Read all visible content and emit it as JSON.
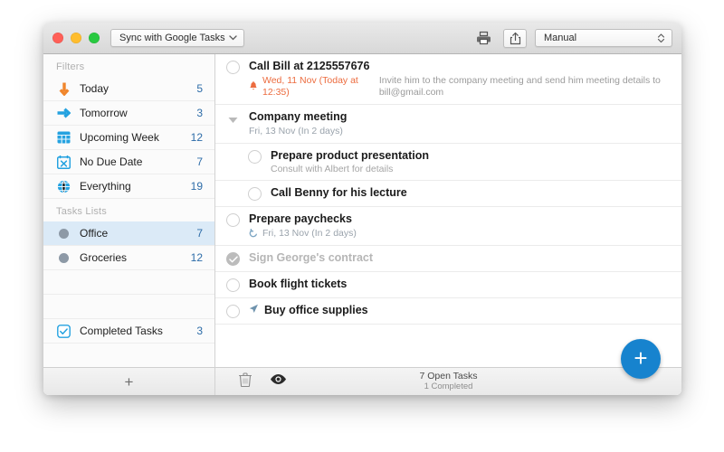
{
  "window": {
    "traffic_lights": [
      "close",
      "minimize",
      "zoom"
    ],
    "sync_popup": {
      "value": "Sync with Google Tasks",
      "icon": "chevron-down-icon"
    },
    "sort_popup": {
      "value": "Manual",
      "icon": "chevron-updown-icon"
    },
    "print_icon": "printer-icon",
    "share_icon": "share-icon"
  },
  "sidebar": {
    "filters_header": "Filters",
    "filters": [
      {
        "label": "Today",
        "count": "5",
        "icon": "arrow-down-icon"
      },
      {
        "label": "Tomorrow",
        "count": "3",
        "icon": "arrow-right-icon"
      },
      {
        "label": "Upcoming Week",
        "count": "12",
        "icon": "calendar-grid-icon"
      },
      {
        "label": "No Due Date",
        "count": "7",
        "icon": "calendar-x-icon"
      },
      {
        "label": "Everything",
        "count": "19",
        "icon": "globe-icon"
      }
    ],
    "lists_header": "Tasks Lists",
    "lists": [
      {
        "label": "Office",
        "count": "7",
        "icon": "list-dot-icon",
        "selected": true
      },
      {
        "label": "Groceries",
        "count": "12",
        "icon": "list-dot-icon",
        "selected": false
      }
    ],
    "completed": {
      "label": "Completed Tasks",
      "count": "3",
      "icon": "checkbox-checked-icon"
    },
    "add_list_icon": "plus-icon"
  },
  "tasks": [
    {
      "title": "Call Bill at 2125557676",
      "state": "open",
      "level": 0,
      "meta_icon": "bell-icon",
      "date": "Wed, 11 Nov (Today at 12:35)",
      "date_style": "due",
      "note": "Invite him to the company meeting and send him meeting details to bill@gmail.com"
    },
    {
      "title": "Company meeting",
      "state": "group",
      "level": 0,
      "meta_icon": "",
      "date": "Fri, 13 Nov (In 2 days)",
      "date_style": "soft",
      "note": ""
    },
    {
      "title": "Prepare product presentation",
      "state": "open",
      "level": 1,
      "meta_icon": "",
      "date": "",
      "date_style": "",
      "note": "",
      "subnote": "Consult with Albert for details"
    },
    {
      "title": "Call Benny for his lecture",
      "state": "open",
      "level": 1,
      "meta_icon": "",
      "date": "",
      "date_style": "",
      "note": ""
    },
    {
      "title": "Prepare paychecks",
      "state": "open",
      "level": 0,
      "meta_icon": "repeat-icon",
      "date": "Fri, 13 Nov (In 2 days)",
      "date_style": "soft",
      "note": ""
    },
    {
      "title": "Sign George's contract",
      "state": "completed",
      "level": 0,
      "meta_icon": "",
      "date": "",
      "date_style": "",
      "note": ""
    },
    {
      "title": "Book flight tickets",
      "state": "open",
      "level": 0,
      "meta_icon": "",
      "date": "",
      "date_style": "",
      "note": ""
    },
    {
      "title": "Buy office supplies",
      "state": "open",
      "level": 0,
      "title_icon": "location-arrow-icon",
      "date": "",
      "date_style": "",
      "note": ""
    }
  ],
  "bottom_bar": {
    "delete_icon": "trash-icon",
    "visibility_icon": "eye-icon",
    "open_tasks": "7 Open Tasks",
    "completed": "1 Completed",
    "add_task_icon": "plus-icon"
  },
  "colors": {
    "accent_blue": "#1783ce",
    "due_orange": "#ec6c3f",
    "selection": "#dbeaf7",
    "count_blue": "#2d6ca8"
  }
}
